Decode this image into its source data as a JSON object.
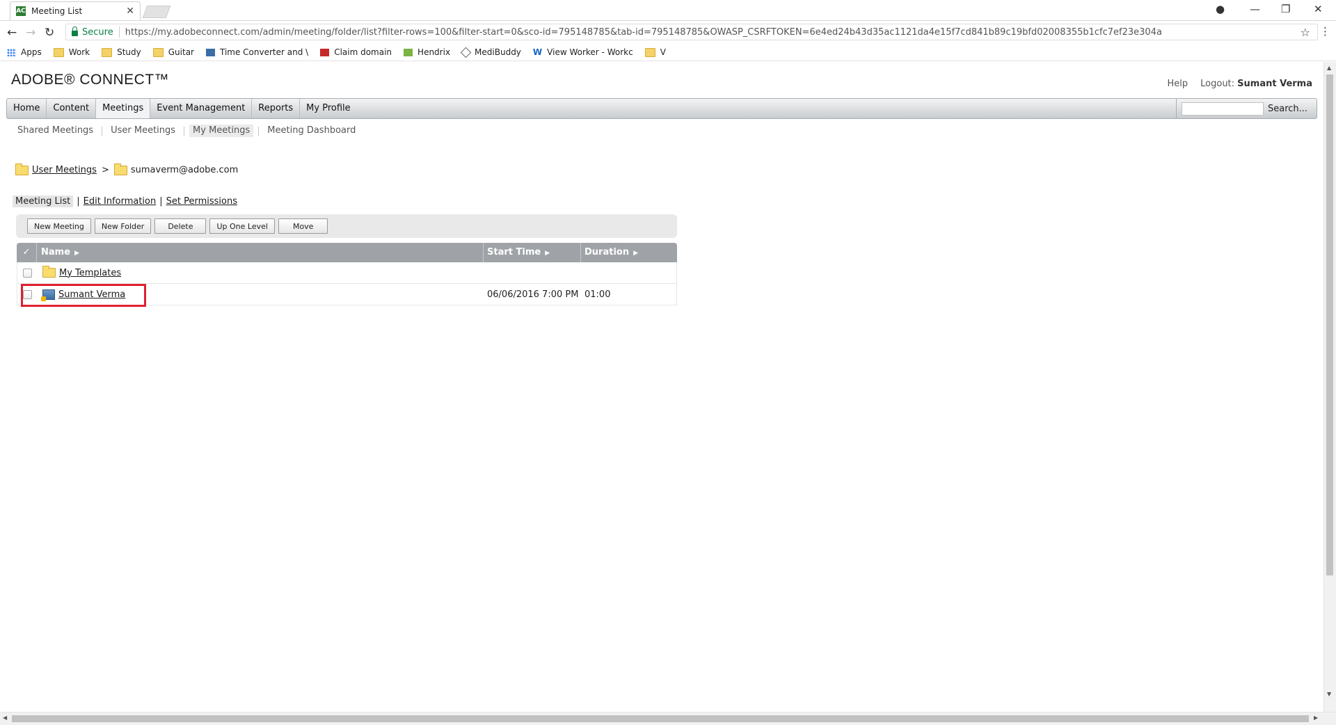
{
  "browser": {
    "tab_title": "Meeting List",
    "tab_favicon": "AC",
    "secure_label": "Secure",
    "url": "https://my.adobeconnect.com/admin/meeting/folder/list?filter-rows=100&filter-start=0&sco-id=795148785&tab-id=795148785&OWASP_CSRFTOKEN=6e4ed24b43d35ac1121da4e15f7cd841b89c19bfd02008355b1cfc7ef23e304a",
    "bookmarks": [
      {
        "label": "Apps",
        "icon": "apps-grid-icon"
      },
      {
        "label": "Work",
        "icon": "folder-icon"
      },
      {
        "label": "Study",
        "icon": "folder-icon"
      },
      {
        "label": "Guitar",
        "icon": "folder-icon"
      },
      {
        "label": "Time Converter and \\",
        "icon": "time-converter-icon"
      },
      {
        "label": "Claim domain",
        "icon": "adobe-icon"
      },
      {
        "label": "Hendrix",
        "icon": "hendrix-icon"
      },
      {
        "label": "MediBuddy",
        "icon": "medibuddy-icon"
      },
      {
        "label": "View Worker - Workc",
        "icon": "workday-icon"
      },
      {
        "label": "V",
        "icon": "folder-icon"
      }
    ]
  },
  "header": {
    "logo": "ADOBE® CONNECT™",
    "help": "Help",
    "logout_label": "Logout:",
    "user_name": "Sumant Verma"
  },
  "nav": {
    "items": [
      "Home",
      "Content",
      "Meetings",
      "Event Management",
      "Reports",
      "My Profile"
    ],
    "active": "Meetings",
    "search_label": "Search..."
  },
  "subnav": {
    "items": [
      "Shared Meetings",
      "User Meetings",
      "My Meetings",
      "Meeting Dashboard"
    ],
    "active": "My Meetings"
  },
  "breadcrumb": {
    "root": "User Meetings",
    "separator": ">",
    "current": "sumaverm@adobe.com"
  },
  "view_tabs": {
    "meeting_list": "Meeting List",
    "edit_information": "Edit Information",
    "set_permissions": "Set Permissions",
    "separator": "|"
  },
  "toolbar": {
    "new_meeting": "New Meeting",
    "new_folder": "New Folder",
    "delete": "Delete",
    "up_one_level": "Up One Level",
    "move": "Move"
  },
  "table": {
    "headers": {
      "check": "✓",
      "name": "Name",
      "start_time": "Start Time",
      "duration": "Duration"
    },
    "rows": [
      {
        "type": "folder",
        "name": "My Templates",
        "start_time": "",
        "duration": ""
      },
      {
        "type": "meeting",
        "name": "Sumant Verma",
        "start_time": "06/06/2016 7:00 PM",
        "duration": "01:00"
      }
    ]
  },
  "colors": {
    "highlight": "#e0202e",
    "nav_gradient_top": "#f4f4f4",
    "grid_header": "#9fa3a7"
  }
}
